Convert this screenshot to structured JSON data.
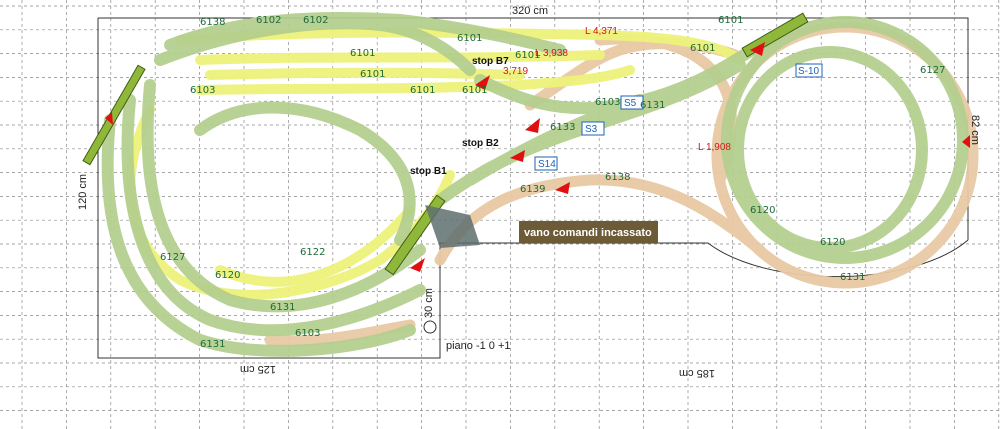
{
  "dimensions": {
    "top_width": "320 cm",
    "left_height": "120 cm",
    "right_height": "82 cm",
    "bottom_left": "125 cm",
    "bottom_right": "185 cm",
    "small_radius": "30 cm"
  },
  "stops": {
    "b7": "stop B7",
    "b2": "stop B2",
    "b1": "stop B1"
  },
  "levels_label": "piano -1   0   +1",
  "control_panel": "vano comandi incassato",
  "red_labels": {
    "l1": "L 4,371",
    "l2": "L 3,938",
    "l3": "3,719",
    "l4": "L 1,908"
  },
  "signals": {
    "s10": "S-10",
    "s14": "S14",
    "s3": "S3",
    "s5": "S5"
  },
  "track_labels": {
    "t6101": "6101",
    "t6102": "6102",
    "t6103": "6103",
    "t6120": "6120",
    "t6122": "6122",
    "t6127": "6127",
    "t6131": "6131",
    "t6133": "6133",
    "t6138": "6138",
    "t6139": "6139"
  },
  "colors": {
    "grid": "#7a7a7a",
    "track_green": "#b3cf8e",
    "track_yellow": "#eef27a",
    "track_tan": "#e8c9a4",
    "signal_red": "#e01010",
    "panel_bg": "#6d5a37"
  }
}
